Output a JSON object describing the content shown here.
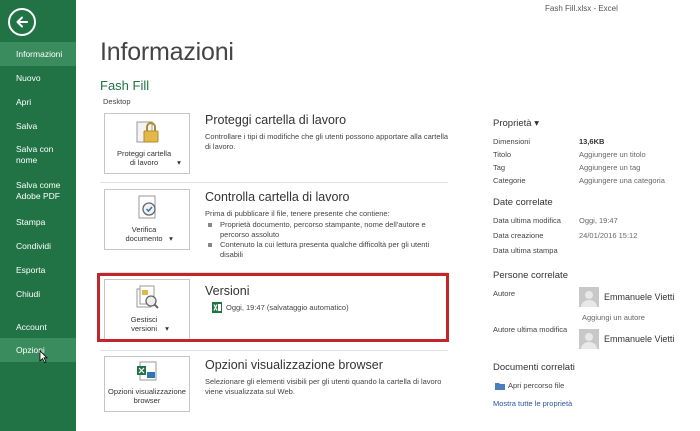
{
  "window": {
    "title": "Fash Fill.xlsx - Excel"
  },
  "sidebar": {
    "items": [
      {
        "label": "Informazioni"
      },
      {
        "label": "Nuovo"
      },
      {
        "label": "Apri"
      },
      {
        "label": "Salva"
      },
      {
        "label": "Salva con nome"
      },
      {
        "label": "Salva come Adobe PDF"
      },
      {
        "label": "Stampa"
      },
      {
        "label": "Condividi"
      },
      {
        "label": "Esporta"
      },
      {
        "label": "Chiudi"
      },
      {
        "label": "Account"
      },
      {
        "label": "Opzioni"
      }
    ],
    "colors": {
      "bg": "#217346",
      "active": "#3a8c5e"
    }
  },
  "main": {
    "title": "Informazioni",
    "file_name": "Fash Fill",
    "location": "Desktop",
    "sections": {
      "protect": {
        "button": "Proteggi cartella di lavoro",
        "title": "Proteggi cartella di lavoro",
        "desc": "Controllare i tipi di modifiche che gli utenti possono apportare alla cartella di lavoro."
      },
      "inspect": {
        "button": "Verifica documento",
        "title": "Controlla cartella di lavoro",
        "desc": "Prima di pubblicare il file, tenere presente che contiene:",
        "bullets": [
          "Proprietà documento, percorso stampante, nome dell'autore e percorso assoluto",
          "Contenuto la cui lettura presenta qualche difficoltà per gli utenti disabili"
        ]
      },
      "versions": {
        "button": "Gestisci versioni",
        "title": "Versioni",
        "entry": "Oggi, 19:47 (salvataggio automatico)"
      },
      "browser": {
        "button": "Opzioni visualizzazione browser",
        "title": "Opzioni visualizzazione browser",
        "desc": "Selezionare gli elementi visibili per gli utenti quando la cartella di lavoro viene visualizzata sul Web."
      }
    }
  },
  "properties": {
    "header": "Proprietà",
    "rows": [
      {
        "label": "Dimensioni",
        "value": "13,6KB"
      },
      {
        "label": "Titolo",
        "value": "Aggiungere un titolo"
      },
      {
        "label": "Tag",
        "value": "Aggiungere un tag"
      },
      {
        "label": "Categorie",
        "value": "Aggiungere una categoria"
      }
    ],
    "dates_header": "Date correlate",
    "dates": [
      {
        "label": "Data ultima modifica",
        "value": "Oggi, 19:47"
      },
      {
        "label": "Data creazione",
        "value": "24/01/2016 15:12"
      },
      {
        "label": "Data ultima stampa",
        "value": ""
      }
    ],
    "people_header": "Persone correlate",
    "author_label": "Autore",
    "author_name": "Emmanuele Vietti",
    "add_author": "Aggiungi un autore",
    "last_modified_by_label": "Autore ultima modifica",
    "last_modified_by_name": "Emmanuele Vietti",
    "docs_header": "Documenti correlati",
    "open_location": "Apri percorso file",
    "show_all": "Mostra tutte le proprietà"
  }
}
